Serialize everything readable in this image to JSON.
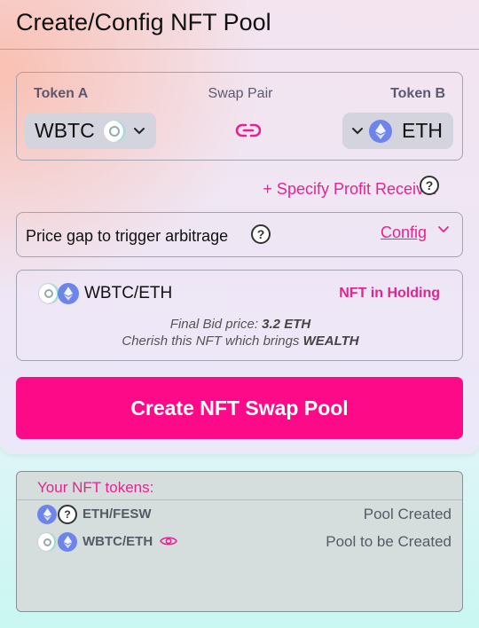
{
  "title": "Create/Config NFT Pool",
  "swap_pair": {
    "token_a_label": "Token A",
    "center_label": "Swap Pair",
    "token_b_label": "Token B",
    "token_a": "WBTC",
    "token_b": "ETH",
    "link_icon": "link-icon"
  },
  "profit_receiver": "+ Specify Profit Receiver",
  "price_gap": {
    "label": "Price gap to trigger arbitrage",
    "config_label": "Config"
  },
  "nft_card": {
    "pair": "WBTC/ETH",
    "status": "NFT in Holding",
    "bid_label": "Final Bid price:",
    "bid_value": "3.2 ETH",
    "tagline_prefix": "Cherish this NFT which brings",
    "tagline_emphasis": "WEALTH"
  },
  "create_button": "Create NFT Swap Pool",
  "your_tokens": {
    "title": "Your NFT tokens:",
    "rows": [
      {
        "pair": "ETH/FESW",
        "status": "Pool Created"
      },
      {
        "pair": "WBTC/ETH",
        "status": "Pool to be Created"
      }
    ]
  },
  "colors": {
    "accent": "#e6248e",
    "button": "#fc0a88",
    "eth": "#6d84ea"
  }
}
